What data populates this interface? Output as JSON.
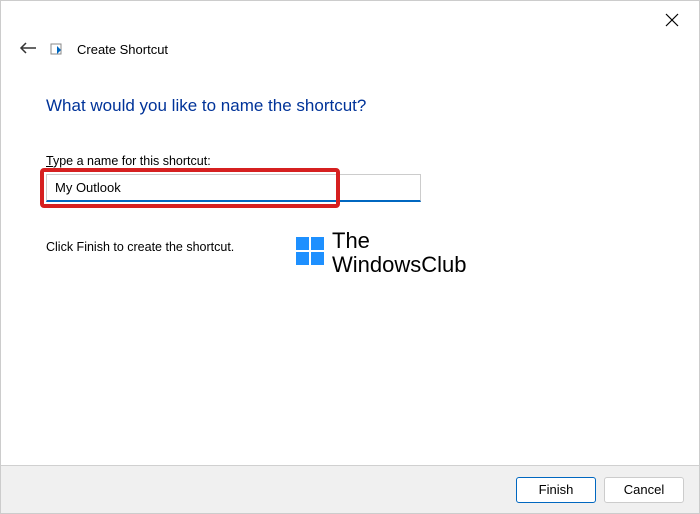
{
  "header": {
    "title": "Create Shortcut"
  },
  "main": {
    "heading": "What would you like to name the shortcut?",
    "field_label_prefix_char": "T",
    "field_label_rest": "ype a name for this shortcut:",
    "input_value": "My Outlook",
    "instruction": "Click Finish to create the shortcut."
  },
  "watermark": {
    "line1": "The",
    "line2": "WindowsClub"
  },
  "footer": {
    "finish_label": "Finish",
    "cancel_label": "Cancel"
  }
}
